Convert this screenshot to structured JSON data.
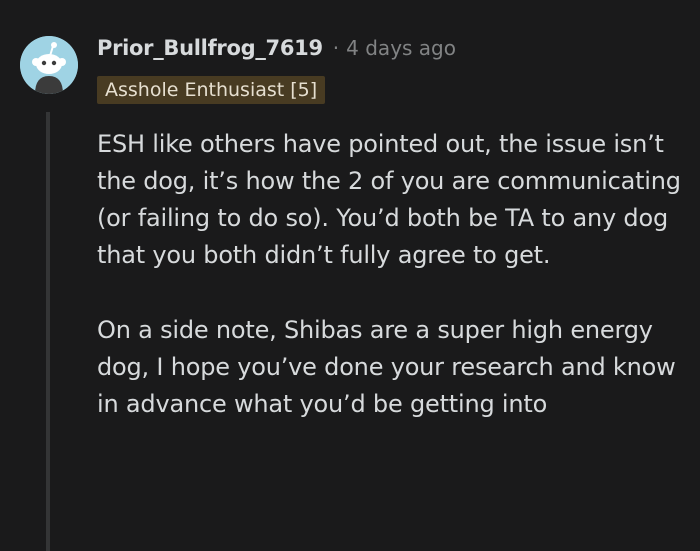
{
  "comment": {
    "username": "Prior_Bullfrog_7619",
    "separator": "·",
    "timestamp": "4 days ago",
    "flair": "Asshole Enthusiast [5]",
    "paragraphs": [
      "ESH like others have pointed out, the issue isn’t the dog, it’s how the 2 of you are communicating (or failing to do so). You’d both be TA to any dog that you both didn’t fully agree to get.",
      "On a side note, Shibas are a super high energy dog, I hope you’ve done your research and know in advance what you’d be getting into"
    ]
  },
  "avatar": {
    "icon": "snoo-avatar-icon",
    "background": "#9fd3e4"
  },
  "colors": {
    "background": "#1a1a1b",
    "text": "#d7dadc",
    "meta": "#818384",
    "flair_bg": "#483b22"
  }
}
